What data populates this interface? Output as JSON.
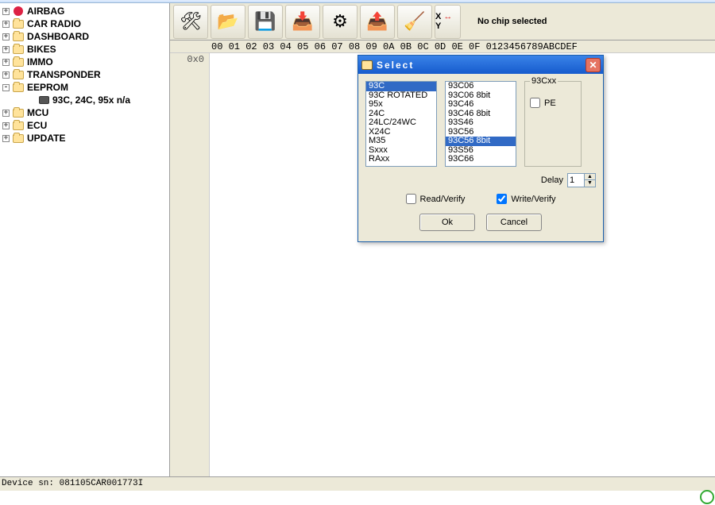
{
  "tree": [
    {
      "label": "AIRBAG",
      "icon": "pin",
      "expander": "+"
    },
    {
      "label": "CAR RADIO",
      "icon": "folder",
      "expander": "+"
    },
    {
      "label": "DASHBOARD",
      "icon": "folder",
      "expander": "+"
    },
    {
      "label": "BIKES",
      "icon": "folder",
      "expander": "+"
    },
    {
      "label": "IMMO",
      "icon": "folder",
      "expander": "+"
    },
    {
      "label": "TRANSPONDER",
      "icon": "folder",
      "expander": "+"
    },
    {
      "label": "EEPROM",
      "icon": "folder",
      "expander": "-",
      "children": [
        {
          "label": "93C, 24C, 95x n/a",
          "icon": "chip"
        }
      ]
    },
    {
      "label": "MCU",
      "icon": "folder",
      "expander": "+"
    },
    {
      "label": "ECU",
      "icon": "folder",
      "expander": "+"
    },
    {
      "label": "UPDATE",
      "icon": "folder",
      "expander": "+"
    }
  ],
  "toolbar": {
    "xy": "X ↔ Y",
    "chip_status": "No chip selected"
  },
  "hex": {
    "header": "00 01 02 03 04 05 06 07 08 09 0A 0B 0C 0D 0E 0F   0123456789ABCDEF",
    "row_addr": "0x0"
  },
  "dialog": {
    "title": "Select",
    "list_a": [
      "93C",
      "93C ROTATED",
      "95x",
      "24C",
      "24LC/24WC",
      "X24C",
      "M35",
      "Sxxx",
      "RAxx"
    ],
    "list_a_selected": "93C",
    "list_b": [
      "93C06",
      "93C06 8bit",
      "93C46",
      "93C46 8bit",
      "93S46",
      "93C56",
      "93C56 8bit",
      "93S56",
      "93C66"
    ],
    "list_b_selected": "93C56 8bit",
    "group_label": "93Cxx",
    "pe_label": "PE",
    "pe_checked": false,
    "delay_label": "Delay",
    "delay_value": "1",
    "read_verify_label": "Read/Verify",
    "read_verify_checked": false,
    "write_verify_label": "Write/Verify",
    "write_verify_checked": true,
    "ok": "Ok",
    "cancel": "Cancel"
  },
  "status": "Device sn: 081105CAR001773I"
}
